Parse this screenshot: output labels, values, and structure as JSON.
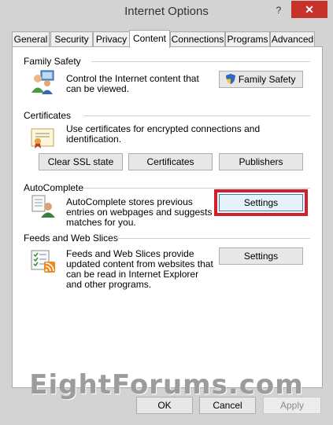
{
  "window": {
    "title": "Internet Options",
    "help_icon": "?",
    "close_icon": "✕"
  },
  "tabs": [
    {
      "label": "General"
    },
    {
      "label": "Security"
    },
    {
      "label": "Privacy"
    },
    {
      "label": "Content",
      "active": true
    },
    {
      "label": "Connections"
    },
    {
      "label": "Programs"
    },
    {
      "label": "Advanced"
    }
  ],
  "family_safety": {
    "title": "Family Safety",
    "description": "Control the Internet content that can be viewed.",
    "button": "Family Safety",
    "icon": "family-safety-users-icon",
    "button_icon": "uac-shield-icon"
  },
  "certificates": {
    "title": "Certificates",
    "description": "Use certificates for encrypted connections and identification.",
    "icon": "certificate-icon",
    "clear_ssl_button": "Clear SSL state",
    "certificates_button": "Certificates",
    "publishers_button": "Publishers"
  },
  "autocomplete": {
    "title": "AutoComplete",
    "description": "AutoComplete stores previous entries on webpages and suggests matches for you.",
    "button": "Settings",
    "icon": "autocomplete-user-icon"
  },
  "feeds": {
    "title": "Feeds and Web Slices",
    "description": "Feeds and Web Slices provide updated content from websites that can be read in Internet Explorer and other programs.",
    "button": "Settings",
    "icon": "feeds-list-icon"
  },
  "footer": {
    "ok": "OK",
    "cancel": "Cancel",
    "apply": "Apply"
  },
  "watermark": "EightForums.com",
  "colors": {
    "highlight": "#d1202b",
    "close_button": "#c7332b",
    "window_frame": "#d3d3d3"
  }
}
